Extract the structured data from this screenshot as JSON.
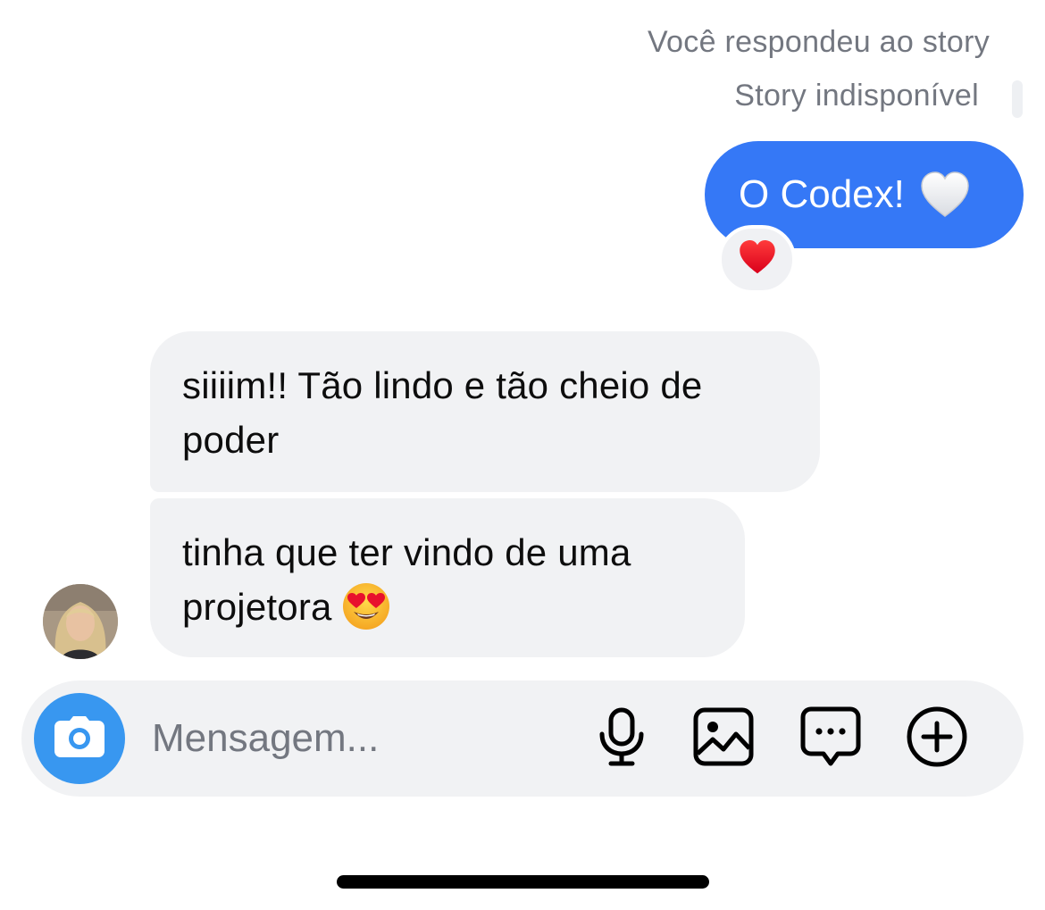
{
  "story_reply": {
    "label": "Você respondeu ao story",
    "unavailable": "Story indisponível"
  },
  "messages": {
    "outgoing": {
      "text": "O Codex!",
      "emoji": "white-heart-icon",
      "reaction": "red-heart-icon"
    },
    "incoming": [
      {
        "text": "siiiim!! Tão lindo e tão cheio de poder"
      },
      {
        "text": "tinha que ter vindo de uma projetora",
        "emoji": "heart-eyes-icon"
      }
    ]
  },
  "composer": {
    "placeholder": "Mensagem...",
    "camera_icon": "camera-icon",
    "tools": [
      "microphone-icon",
      "image-icon",
      "sticker-chat-icon",
      "plus-circle-icon"
    ]
  },
  "colors": {
    "outgoing_bubble": "#3578f6",
    "incoming_bubble": "#f1f2f4",
    "camera_button": "#3897f0",
    "muted_text": "#737780"
  }
}
